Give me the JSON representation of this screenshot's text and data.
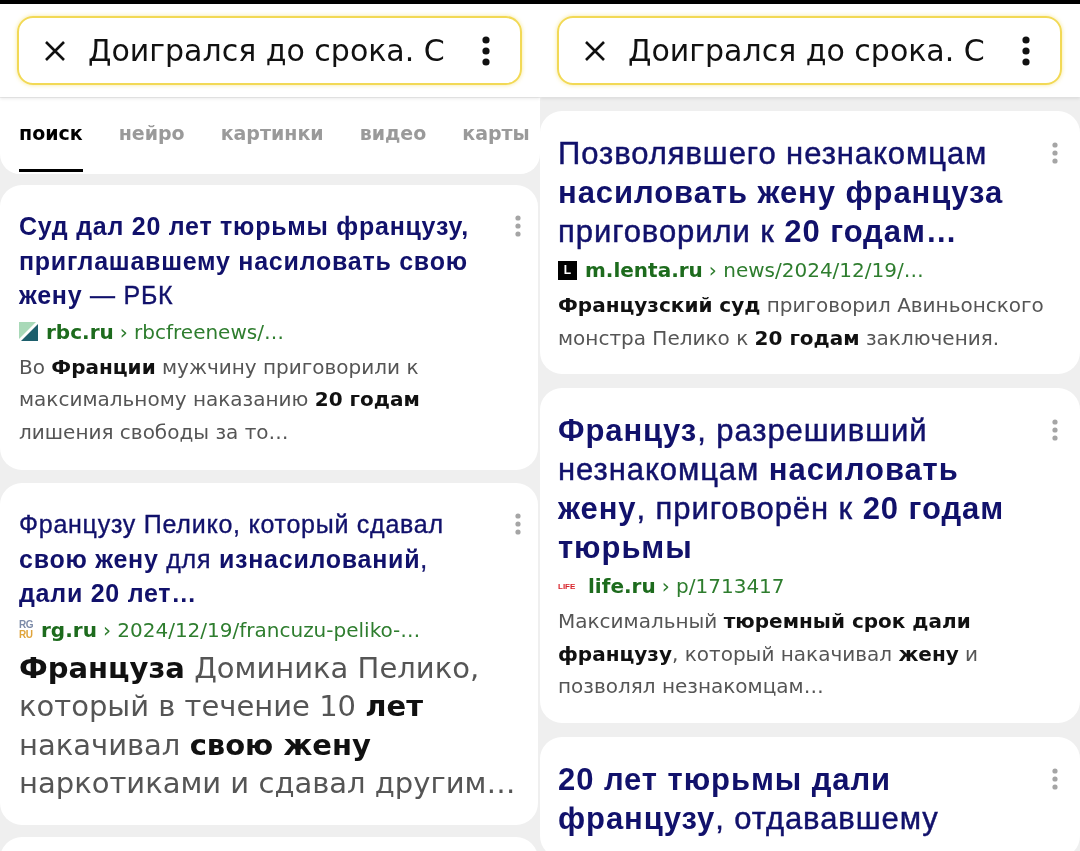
{
  "panels": [
    {
      "search": {
        "value": "Доигрался до срока. С"
      },
      "tabs": [
        {
          "label": "поиск",
          "selected": true
        },
        {
          "label": "нейро",
          "selected": false
        },
        {
          "label": "картинки",
          "selected": false
        },
        {
          "label": "видео",
          "selected": false
        },
        {
          "label": "карты",
          "selected": false
        }
      ],
      "results": [
        {
          "title": "**Суд дал 20 лет тюрьмы французу, приглашавшему насиловать свою жену** — РБК",
          "source": {
            "icon": {
              "kind": "rbc"
            },
            "domain": "rbc.ru",
            "path": "› rbcfreenews/…"
          },
          "snippet": "Во **Франции** мужчину приговорили к максимальному наказанию **20 годам** лишения свободы за то…"
        },
        {
          "title": "Французу Пелико, который сдавал **свою жену** для **изнасилований**, **дали 20 лет…**",
          "source": {
            "icon": {
              "kind": "rg",
              "lines": [
                "RG",
                "RU"
              ]
            },
            "domain": "rg.ru",
            "path": "› 2024/12/19/francuzu-peliko-…"
          },
          "snippet": "**Француза** Доминика Пелико, который в течение 10 **лет** накачивал **свою жену** наркотиками и сдавал другим…"
        }
      ]
    },
    {
      "search": {
        "value": "Доигрался до срока. С"
      },
      "results": [
        {
          "title": "Позволявшего незнакомцам **насиловать жену француза** приговорили к **20 годам…**",
          "source": {
            "icon": {
              "kind": "lenta",
              "lines": [
                "L"
              ]
            },
            "domain": "m.lenta.ru",
            "path": "› news/2024/12/19/…"
          },
          "snippet": "**Французский суд** приговорил Авиньонского монстра Пелико к **20 годам** заключения."
        },
        {
          "title": "**Француз**, разрешивший незнакомцам **насиловать жену**, приговорён к **20 годам тюрьмы**",
          "source": {
            "icon": {
              "kind": "life",
              "lines": [
                "LIFE"
              ]
            },
            "domain": "life.ru",
            "path": "› p/1713417"
          },
          "snippet": "Максимальный **тюремный срок дали французу**, который накачивал **жену** и позволял незнакомцам…"
        },
        {
          "title": "**20 лет тюрьмы дали французу**, отдававшему"
        }
      ]
    }
  ]
}
